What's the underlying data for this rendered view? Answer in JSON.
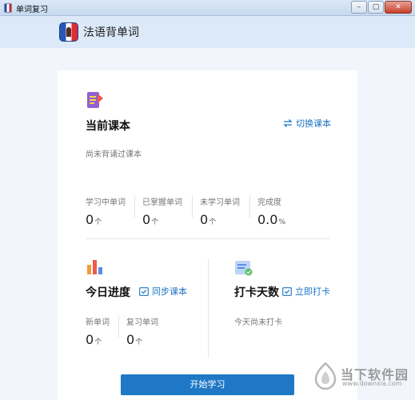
{
  "window": {
    "title": "单词复习",
    "buttons": [
      "–",
      "▢",
      "✕"
    ]
  },
  "app": {
    "name": "法语背单词"
  },
  "current_book": {
    "title": "当前课本",
    "switch_label": "切换课本",
    "status": "尚未背诵过课本",
    "stats": [
      {
        "label": "学习中单词",
        "value": "0",
        "unit": "个"
      },
      {
        "label": "已掌握单词",
        "value": "0",
        "unit": "个"
      },
      {
        "label": "未学习单词",
        "value": "0",
        "unit": "个"
      },
      {
        "label": "完成度",
        "value": "0.0",
        "unit": "%"
      }
    ]
  },
  "today": {
    "title": "今日进度",
    "sync_label": "同步课本",
    "stats": [
      {
        "label": "新单词",
        "value": "0",
        "unit": "个"
      },
      {
        "label": "复习单词",
        "value": "0",
        "unit": "个"
      }
    ]
  },
  "checkin": {
    "title": "打卡天数",
    "action_label": "立即打卡",
    "status": "今天尚未打卡"
  },
  "start_button": "开始学习",
  "watermark": {
    "line1": "当下软件园",
    "line2": "www.downxia.com"
  }
}
